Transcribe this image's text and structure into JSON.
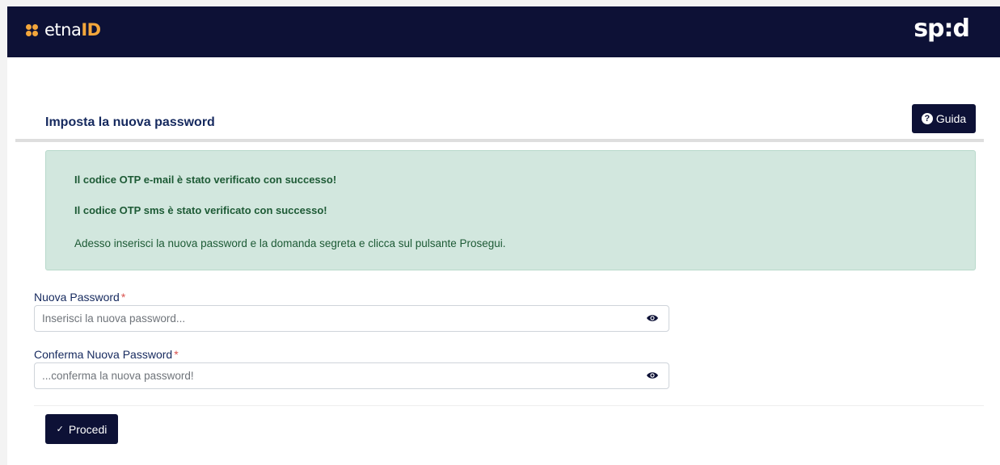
{
  "header": {
    "logo_left_prefix": "etna",
    "logo_left_suffix": "ID",
    "logo_right": "sp:d"
  },
  "page": {
    "title": "Imposta la nuova password",
    "guida_label": "Guida",
    "guida_icon": "?"
  },
  "alert": {
    "line1": "Il codice OTP e-mail è stato verificato con successo!",
    "line2": "Il codice OTP sms è stato verificato con successo!",
    "line3": "Adesso inserisci la nuova password e la domanda segreta e clicca sul pulsante Prosegui."
  },
  "form": {
    "new_password": {
      "label": "Nuova Password",
      "required_mark": "*",
      "placeholder": "Inserisci la nuova password...",
      "value": ""
    },
    "confirm_password": {
      "label": "Conferma Nuova Password",
      "required_mark": "*",
      "placeholder": "...conferma la nuova password!",
      "value": ""
    },
    "submit_label": "Procedi",
    "submit_icon": "✓"
  },
  "colors": {
    "navy": "#0d1136",
    "accent_orange": "#f3a63b",
    "title_blue": "#15295e",
    "success_bg": "#d2e7de",
    "success_text": "#1d5a35",
    "required_red": "#d9534f"
  }
}
